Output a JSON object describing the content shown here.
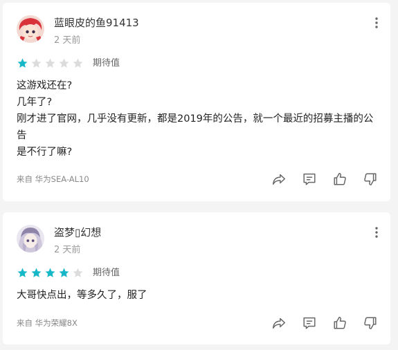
{
  "reviews": [
    {
      "username": "蓝眼皮的鱼91413",
      "time": "2 天前",
      "rating": 1,
      "max_rating": 5,
      "rating_label": "期待值",
      "lines": [
        "这游戏还在?",
        "几年了?",
        "刚才进了官网，几乎没有更新，都是2019年的公告，就一个最近的招募主播的公告",
        "是不行了嘛?"
      ],
      "device": "来自 华为SEA-AL10",
      "avatar_icon": "red-haired-avatar"
    },
    {
      "username": "盗梦▯幻想",
      "time": "2 天前",
      "rating": 4,
      "max_rating": 5,
      "rating_label": "期待值",
      "lines": [
        "大哥快点出，等多久了，服了"
      ],
      "device": "来自 华为荣耀8X",
      "avatar_icon": "silver-haired-avatar"
    }
  ],
  "colors": {
    "star_filled": "#16b7c6",
    "star_empty": "#dcdcdc",
    "icon": "#666666"
  },
  "icons": [
    "more-icon",
    "share-icon",
    "comment-icon",
    "thumbs-up-icon",
    "thumbs-down-icon"
  ]
}
